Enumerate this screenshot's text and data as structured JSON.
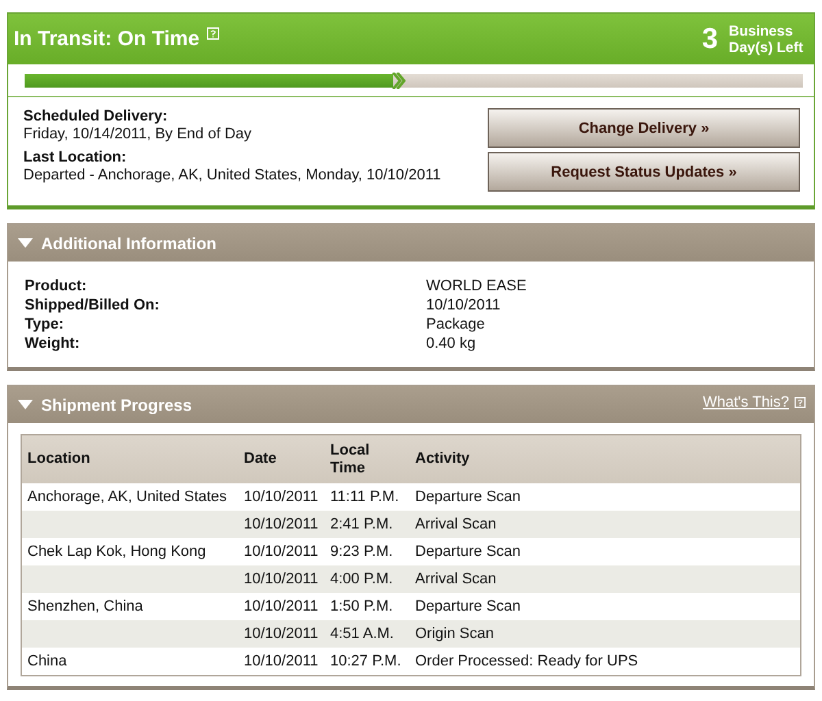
{
  "status": {
    "title": "In Transit: On Time",
    "days_count": "3",
    "days_label": "Business Day(s) Left",
    "progress": {
      "level": 0.49
    },
    "scheduled_label": "Scheduled Delivery:",
    "scheduled_value": "Friday, 10/14/2011, By End of Day",
    "last_label": "Last Location:",
    "last_value": "Departed - Anchorage, AK, United States, Monday, 10/10/2011",
    "buttons": [
      "Change Delivery »",
      "Request Status Updates »"
    ]
  },
  "additional": {
    "title": "Additional Information",
    "expanded": true,
    "fields": [
      {
        "label": "Product:",
        "value": "WORLD EASE"
      },
      {
        "label": "Shipped/Billed On:",
        "value": "10/10/2011"
      },
      {
        "label": "Type:",
        "value": "Package"
      },
      {
        "label": "Weight:",
        "value": "0.40 kg"
      }
    ]
  },
  "progress": {
    "title": "Shipment Progress",
    "expanded": true,
    "help_link": "What's This?",
    "columns": [
      "Location",
      "Date",
      "Local Time",
      "Activity"
    ],
    "rows": [
      {
        "location": "Anchorage, AK, United States",
        "date": "10/10/2011",
        "time": "11:11 P.M.",
        "activity": "Departure Scan"
      },
      {
        "date": "10/10/2011",
        "time": "2:41 P.M.",
        "activity": "Arrival Scan"
      },
      {
        "location": "Chek Lap Kok, Hong Kong",
        "date": "10/10/2011",
        "time": "9:23 P.M.",
        "activity": "Departure Scan"
      },
      {
        "date": "10/10/2011",
        "time": "4:00 P.M.",
        "activity": "Arrival Scan"
      },
      {
        "location": "Shenzhen, China",
        "date": "10/10/2011",
        "time": "1:50 P.M.",
        "activity": "Departure Scan"
      },
      {
        "date": "10/10/2011",
        "time": "4:51 A.M.",
        "activity": "Origin Scan"
      },
      {
        "location": "China",
        "date": "10/10/2011",
        "time": "10:27 P.M.",
        "activity": "Order Processed: Ready for UPS"
      }
    ]
  }
}
